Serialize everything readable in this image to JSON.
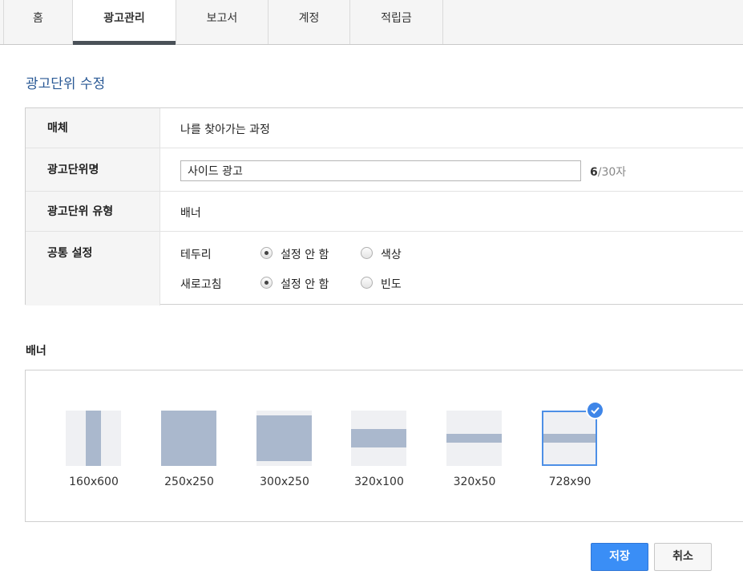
{
  "tabs": [
    {
      "label": "홈"
    },
    {
      "label": "광고관리"
    },
    {
      "label": "보고서"
    },
    {
      "label": "계정"
    },
    {
      "label": "적립금"
    }
  ],
  "page_title": "광고단위 수정",
  "form": {
    "media": {
      "label": "매체",
      "value": "나를 찾아가는 과정"
    },
    "unit_name": {
      "label": "광고단위명",
      "value": "사이드 광고",
      "count": "6",
      "max": "/30자"
    },
    "unit_type": {
      "label": "광고단위 유형",
      "value": "배너"
    },
    "common": {
      "label": "공통 설정",
      "border": {
        "label": "테두리",
        "options": [
          "설정 안 함",
          "색상"
        ],
        "selected": "설정 안 함"
      },
      "refresh": {
        "label": "새로고침",
        "options": [
          "설정 안 함",
          "빈도"
        ],
        "selected": "설정 안 함"
      }
    }
  },
  "banner": {
    "title": "배너",
    "sizes": [
      "160x600",
      "250x250",
      "300x250",
      "320x100",
      "320x50",
      "728x90"
    ],
    "selected": "728x90"
  },
  "buttons": {
    "save": "저장",
    "cancel": "취소"
  },
  "colors": {
    "accent": "#3a8ef6",
    "title": "#2b5a96",
    "thumb_fill": "#aab8cd"
  }
}
